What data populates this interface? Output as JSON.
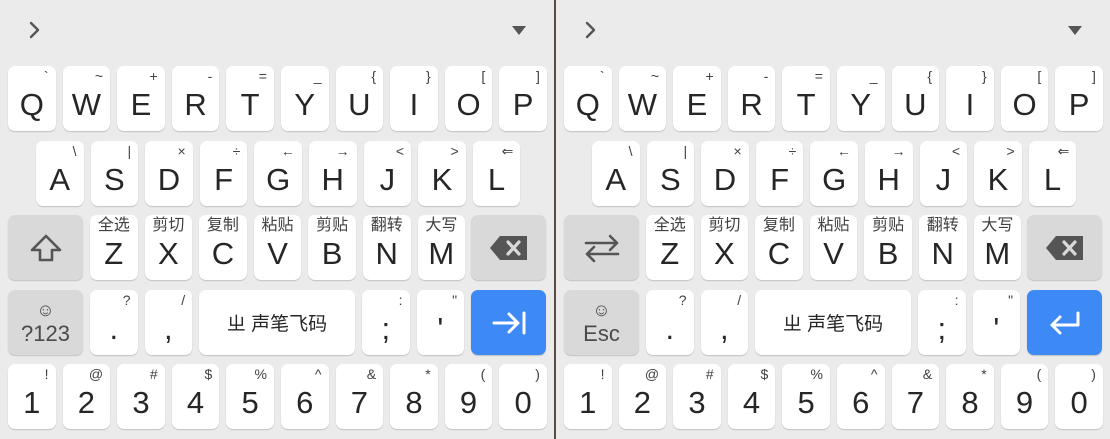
{
  "colors": {
    "background": "#ebebeb",
    "key": "#ffffff",
    "function_key": "#d9d9d9",
    "accent_key": "#3d8af7",
    "divider": "#5a4a44"
  },
  "toolbar": {
    "expand_icon": "chevron-right-icon",
    "collapse_icon": "triangle-down-icon"
  },
  "rows": {
    "qwerty": [
      {
        "main": "Q",
        "sub": "`"
      },
      {
        "main": "W",
        "sub": "~"
      },
      {
        "main": "E",
        "sub": "+"
      },
      {
        "main": "R",
        "sub": "-"
      },
      {
        "main": "T",
        "sub": "="
      },
      {
        "main": "Y",
        "sub": "_"
      },
      {
        "main": "U",
        "sub": "{"
      },
      {
        "main": "I",
        "sub": "}"
      },
      {
        "main": "O",
        "sub": "["
      },
      {
        "main": "P",
        "sub": "]"
      }
    ],
    "asdf": [
      {
        "main": "A",
        "sub": "\\"
      },
      {
        "main": "S",
        "sub": "|"
      },
      {
        "main": "D",
        "sub": "×"
      },
      {
        "main": "F",
        "sub": "÷"
      },
      {
        "main": "G",
        "sub": "←"
      },
      {
        "main": "H",
        "sub": "→"
      },
      {
        "main": "J",
        "sub": "<"
      },
      {
        "main": "K",
        "sub": ">"
      },
      {
        "main": "L",
        "sub": "⇐"
      }
    ],
    "zxcv": [
      {
        "main": "Z",
        "sub": "全选"
      },
      {
        "main": "X",
        "sub": "剪切"
      },
      {
        "main": "C",
        "sub": "复制"
      },
      {
        "main": "V",
        "sub": "粘贴"
      },
      {
        "main": "B",
        "sub": "剪贴"
      },
      {
        "main": "N",
        "sub": "翻转"
      },
      {
        "main": "M",
        "sub": "大写"
      }
    ],
    "numbers": [
      {
        "main": "1",
        "sub": "!"
      },
      {
        "main": "2",
        "sub": "@"
      },
      {
        "main": "3",
        "sub": "#"
      },
      {
        "main": "4",
        "sub": "$"
      },
      {
        "main": "5",
        "sub": "%"
      },
      {
        "main": "6",
        "sub": "^"
      },
      {
        "main": "7",
        "sub": "&"
      },
      {
        "main": "8",
        "sub": "*"
      },
      {
        "main": "9",
        "sub": "("
      },
      {
        "main": "0",
        "sub": ")"
      }
    ]
  },
  "bottom": {
    "period": {
      "main": ".",
      "sub": "?"
    },
    "comma": {
      "main": ",",
      "sub": "/"
    },
    "space_label": "ㄓ 声笔飞码",
    "semicolon": {
      "main": ";",
      "sub": ":"
    },
    "quote": {
      "main": "'",
      "sub": "\""
    }
  },
  "left_keyboard": {
    "shift_icon": "shift-arrow-up-icon",
    "symbol_key": {
      "emoji": "☺",
      "label": "?123"
    },
    "action_icon": "tab-arrow-icon"
  },
  "right_keyboard": {
    "switch_icon": "swap-arrows-icon",
    "symbol_key": {
      "emoji": "☺",
      "label": "Esc"
    },
    "action_icon": "enter-return-icon"
  },
  "backspace_icon": "backspace-icon"
}
